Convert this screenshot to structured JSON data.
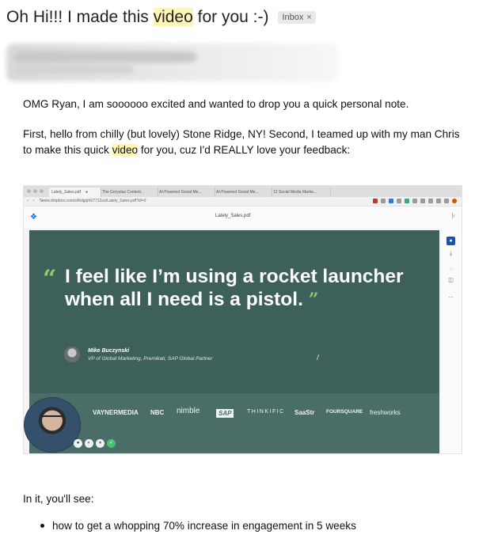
{
  "subject": {
    "before": "Oh Hi!!! I made this ",
    "highlight": "video",
    "after": " for you :-)"
  },
  "label_chip": {
    "label": "Inbox",
    "close": "×"
  },
  "body": {
    "p1": "OMG Ryan, I am soooooo excited and wanted to drop you a quick personal note.",
    "p2_line1": "First, hello from chilly (but lovely) Stone Ridge, NY! Second, I teamed up with my man Chris",
    "p2_line2_before": "to make this quick ",
    "p2_line2_highlight": "video",
    "p2_line2_after": " for you, cuz I'd REALLY love your feedback:",
    "p3": "In it, you'll see:",
    "bullets": [
      "how to get a whopping 70% increase in engagement in 5 weeks"
    ]
  },
  "video_preview": {
    "tabs": [
      "Lately_Sales.pdf",
      "The Gorystax Content...",
      "AI-Powered Social Me...",
      "AI-Powered Social Me...",
      "12 Social Media Marke..."
    ],
    "url": "www.dropbox.com/s/fkdgqlr6/7712us/Lately_Sales.pdf?dl=0",
    "file_title": "Lately_Sales.pdf",
    "quote_open": "“",
    "quote": "I feel like I’m using a rocket launcher when all I need is a pistol.",
    "quote_close": "”",
    "author_name": "Mike Buczynski",
    "author_role": "VP of Global Marketing, Premikati, SAP Global Partner",
    "logos": [
      "VAYNERMEDIA",
      "NBC",
      "nimble",
      "SAP",
      "THINKIFIC",
      "SaaStr",
      "FOURSQUARE",
      "freshworks"
    ],
    "controls": [
      "●",
      "◐",
      "⏸",
      "✓"
    ],
    "rail_icons": [
      "user-icon",
      "download-icon",
      "comment-icon",
      "share-icon",
      "more-icon"
    ],
    "colors": {
      "slide_bg": "#3d615a",
      "quote_accent": "#8fc96a",
      "dropbox_blue": "#0a6adf"
    }
  },
  "colors": {
    "highlight": "#fff5b8"
  }
}
